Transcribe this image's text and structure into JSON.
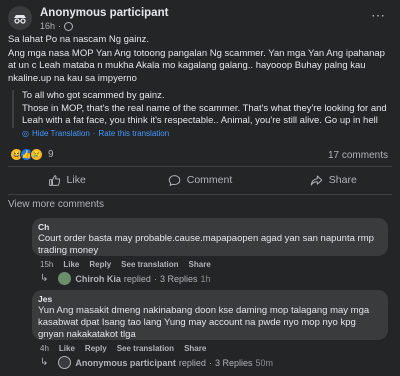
{
  "post": {
    "author": "Anonymous participant",
    "time": "16h",
    "time_sep": "·",
    "more_icon": "⋯",
    "text": "Sa lahat Po na nascam Ng gainz.\nAng mga nasa MOP Yan Ang totoong pangalan Ng scammer. Yan mga Yan Ang ipahanap at un c Leah mataba n mukha Akala mo kagalang galang.. hayooop Buhay palng kau nkaline.up na kau sa impyerno",
    "translation": "To all who got scammed by gainz.\nThose in MOP, that's the real name of the scammer. That's what they're looking for and Leah with a fat face, you think it's respectable.. Animal, you're still alive. Go up in hell",
    "hide_translation": "Hide Translation",
    "hide_translation_sep": "·",
    "rate_translation": "Rate this translation",
    "reaction_count": "9",
    "comment_count": "17 comments"
  },
  "actions": {
    "like": "Like",
    "comment": "Comment",
    "share": "Share"
  },
  "view_more": "View more comments",
  "comments": [
    {
      "name": "Ch",
      "text": "Court order basta may probable.cause.mapapaopen agad yan san napunta rmp trading money",
      "time": "15h",
      "like": "Like",
      "reply": "Reply",
      "see_translation": "See translation",
      "share": "Share",
      "reply_name": "Chiroh Kia",
      "reply_label": "replied",
      "reply_sep": "·",
      "reply_count": "3 Replies",
      "reply_time": "1h"
    },
    {
      "name": "Jes",
      "text": "Yun Ang masakit dmeng nakinabang doon kse daming mop talagang may mga kasabwat dpat Isang tao lang Yung may account na pwde nyo mop nyo kpg gnyan nakakatakot tlga",
      "time": "4h",
      "like": "Like",
      "reply": "Reply",
      "see_translation": "See translation",
      "share": "Share",
      "reply_name": "Anonymous participant",
      "reply_label": "replied",
      "reply_sep": "·",
      "reply_count": "3 Replies",
      "reply_time": "50m"
    }
  ],
  "colors": {
    "background": "#242526",
    "bubble": "#3a3b3c",
    "link": "#4599ff",
    "muted": "#b0b3b8"
  }
}
